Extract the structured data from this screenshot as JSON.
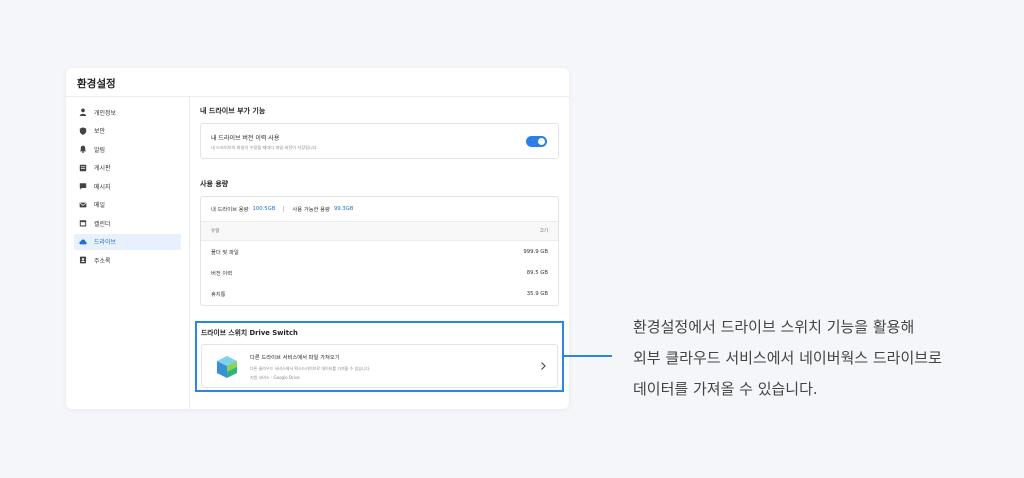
{
  "window": {
    "title": "환경설정"
  },
  "sidebar": {
    "items": [
      {
        "label": "개인정보",
        "icon": "person-icon",
        "active": false
      },
      {
        "label": "보안",
        "icon": "shield-icon",
        "active": false
      },
      {
        "label": "알림",
        "icon": "bell-icon",
        "active": false
      },
      {
        "label": "게시판",
        "icon": "board-icon",
        "active": false
      },
      {
        "label": "메시지",
        "icon": "message-icon",
        "active": false
      },
      {
        "label": "메일",
        "icon": "mail-icon",
        "active": false
      },
      {
        "label": "캘린더",
        "icon": "calendar-icon",
        "active": false
      },
      {
        "label": "드라이브",
        "icon": "cloud-icon",
        "active": true
      },
      {
        "label": "주소록",
        "icon": "contacts-icon",
        "active": false
      }
    ]
  },
  "addons": {
    "section_title": "내 드라이브 부가 기능",
    "version_title": "내 드라이브 버전 이력 사용",
    "version_desc": "내 드라이브의 파일이 수정될 때마다 파일 버전이 저장됩니다.",
    "toggle_on": true
  },
  "usage": {
    "section_title": "사용 용량",
    "my_label": "내 드라이브 용량",
    "my_value": "100.5GB",
    "avail_label": "사용 가능한 용량",
    "avail_value": "99.3GB",
    "col_type": "유형",
    "col_size": "크기",
    "rows": [
      {
        "type": "폴더 및 파일",
        "size": "999.9 GB"
      },
      {
        "type": "버전 이력",
        "size": "89.5 GB"
      },
      {
        "type": "휴지통",
        "size": "35.9 GB"
      }
    ]
  },
  "drive_switch": {
    "section_title": "드라이브 스위치 Drive Switch",
    "main": "다른 드라이브 서비스에서 파일 가져오기",
    "desc": "다른 클라우드 서비스에서 웍스드라이브로 데이터를 가져올 수 있습니다.",
    "support": "지원 서비스 : Google Drive"
  },
  "caption": {
    "line1": "환경설정에서 드라이브 스위치 기능을 활용해",
    "line2": "외부 클라우드 서비스에서 네이버웍스 드라이브로",
    "line3": "데이터를 가져올 수 있습니다."
  },
  "colors": {
    "accent": "#2b86e0",
    "active_bg": "#e7f0fb",
    "value_blue": "#1f6ed4"
  }
}
